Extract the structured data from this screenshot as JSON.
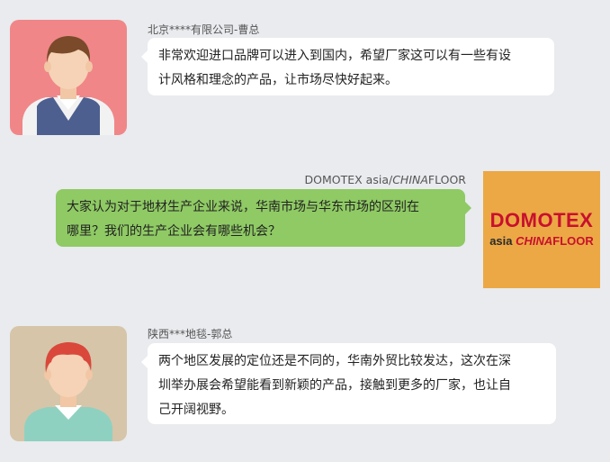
{
  "messages": [
    {
      "sender": "北京****有限公司-曹总",
      "text_lines": [
        "非常欢迎进口品牌可以进入到国内，希望厂家这可以有一些有设",
        "计风格和理念的产品，让市场尽快好起来。"
      ]
    },
    {
      "sender_prefix": "DOMOTEX asia/",
      "sender_suffix": "CHINA",
      "sender_tail": "FLOOR",
      "text_lines": [
        "大家认为对于地材生产企业来说，华南市场与华东市场的区别在",
        "哪里？我们的生产企业会有哪些机会？"
      ]
    },
    {
      "sender": "陕西***地毯-郭总",
      "text_lines": [
        "两个地区发展的定位还是不同的，华南外贸比较发达，这次在深",
        "圳举办展会希望能看到新颖的产品，接触到更多的厂家，也让自",
        "己开阔视野。"
      ]
    }
  ],
  "logo": {
    "line1": "DOMOTEX",
    "asia": "asia",
    "china": "CHINA",
    "floor": "FLOOR"
  },
  "colors": {
    "background": "#e9ebee",
    "bubble_green": "#8fca64",
    "bubble_white": "#ffffff",
    "avatar1_bg": "#f08688",
    "avatar3_bg": "#d6c5a9",
    "logo_bg": "#eca845",
    "logo_red": "#c8102e"
  }
}
